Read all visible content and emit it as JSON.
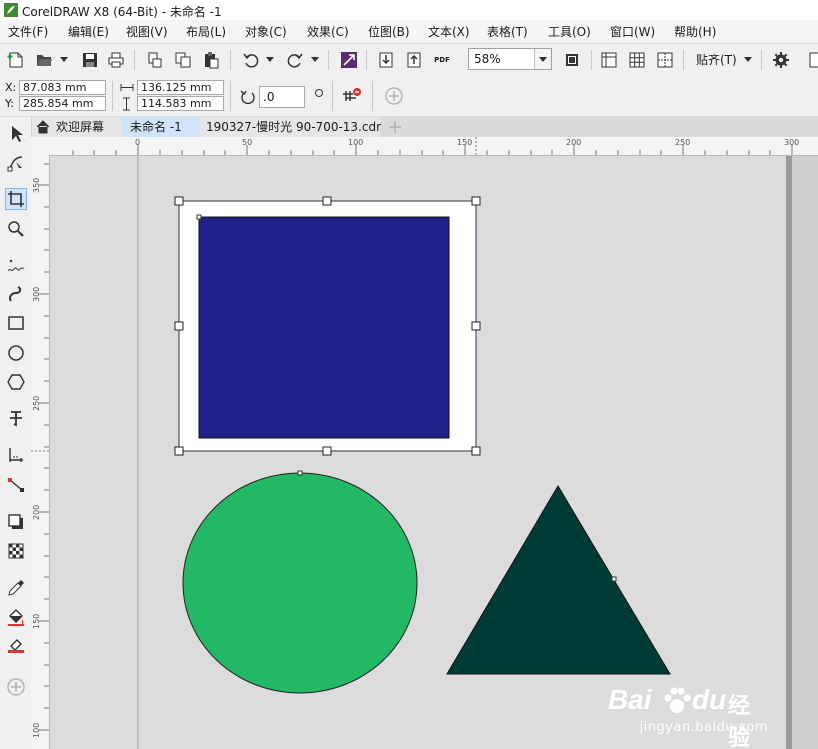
{
  "window": {
    "title": "CorelDRAW X8 (64-Bit) - 未命名 -1"
  },
  "menu": [
    "文件(F)",
    "编辑(E)",
    "视图(V)",
    "布局(L)",
    "对象(C)",
    "效果(C)",
    "位图(B)",
    "文本(X)",
    "表格(T)",
    "工具(O)",
    "窗口(W)",
    "帮助(H)"
  ],
  "toolbar": {
    "zoom": "58%",
    "snap_label": "贴齐(T)",
    "pdf_label": "PDF"
  },
  "properties": {
    "x_label": "X:",
    "x_value": "87.083 mm",
    "y_label": "Y:",
    "y_value": "285.854 mm",
    "width_value": "136.125 mm",
    "height_value": "114.583 mm",
    "rotation_value": ".0"
  },
  "tabs": [
    {
      "label": "欢迎屏幕",
      "active": false
    },
    {
      "label": "未命名 -1",
      "active": true
    },
    {
      "label": "190327-慢时光 90-700-13.cdr",
      "active": false
    }
  ],
  "ruler": {
    "h_labels": [
      "0",
      "50",
      "100",
      "150",
      "200",
      "250",
      "300"
    ],
    "v_labels": [
      "350",
      "300",
      "250",
      "200",
      "150",
      "100"
    ]
  },
  "tools": [
    "pick-tool",
    "shape-tool",
    "crop-tool",
    "zoom-tool",
    "freehand-tool",
    "artistic-media-tool",
    "rectangle-tool",
    "ellipse-tool",
    "polygon-tool",
    "text-tool",
    "parallel-dimension-tool",
    "connector-tool",
    "drop-shadow-tool",
    "transparency-tool",
    "eyedropper-tool",
    "interactive-fill-tool",
    "smart-fill-tool",
    "add-tool"
  ],
  "shapes": {
    "rectangle_color": "#1f2189",
    "ellipse_color": "#22b866",
    "triangle_color": "#003b38"
  },
  "watermark": {
    "brand_a": "Bai",
    "brand_b": "du",
    "brand_cn": "经验",
    "url": "jingyan.baidu.com"
  }
}
